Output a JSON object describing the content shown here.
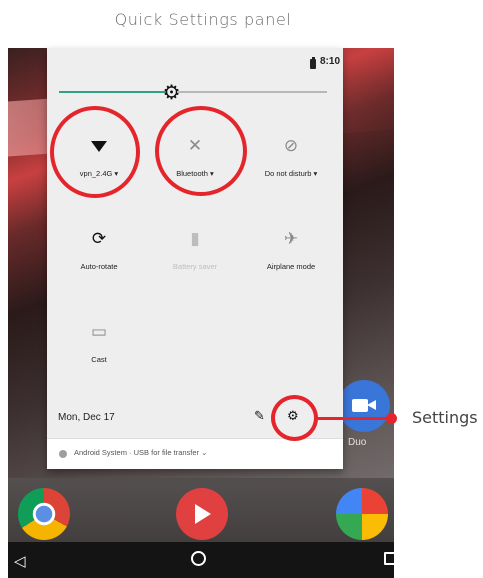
{
  "caption": "Quick Settings panel",
  "status_bar": {
    "time": "8:10",
    "battery_icon": "battery-icon"
  },
  "brightness": {
    "level": 0.42,
    "icon": "brightness-icon"
  },
  "tiles": [
    {
      "label": "vpn_2.4G",
      "caret": "▾",
      "icon": "wifi-icon",
      "state": "on"
    },
    {
      "label": "Bluetooth",
      "caret": "▾",
      "icon": "bluetooth-off-icon",
      "state": "off"
    },
    {
      "label": "Do not disturb",
      "caret": "▾",
      "icon": "do-not-disturb-icon",
      "state": "off"
    },
    {
      "label": "Auto-rotate",
      "icon": "auto-rotate-icon",
      "state": "on"
    },
    {
      "label": "Battery saver",
      "icon": "battery-saver-icon",
      "state": "unavailable"
    },
    {
      "label": "Airplane mode",
      "icon": "airplane-mode-icon",
      "state": "off"
    },
    {
      "label": "Cast",
      "icon": "cast-icon",
      "state": "off"
    }
  ],
  "footer": {
    "date": "Mon, Dec 17",
    "edit_icon": "pencil-icon",
    "settings_icon": "gear-icon"
  },
  "notification": {
    "text": "Android System · USB for file transfer ⌄"
  },
  "home": {
    "duo_label": "Duo"
  },
  "annotation": {
    "label": "Settings",
    "color": "#e4252c"
  },
  "colors": {
    "accent": "#2fa08a",
    "panel": "#eeeeee"
  }
}
